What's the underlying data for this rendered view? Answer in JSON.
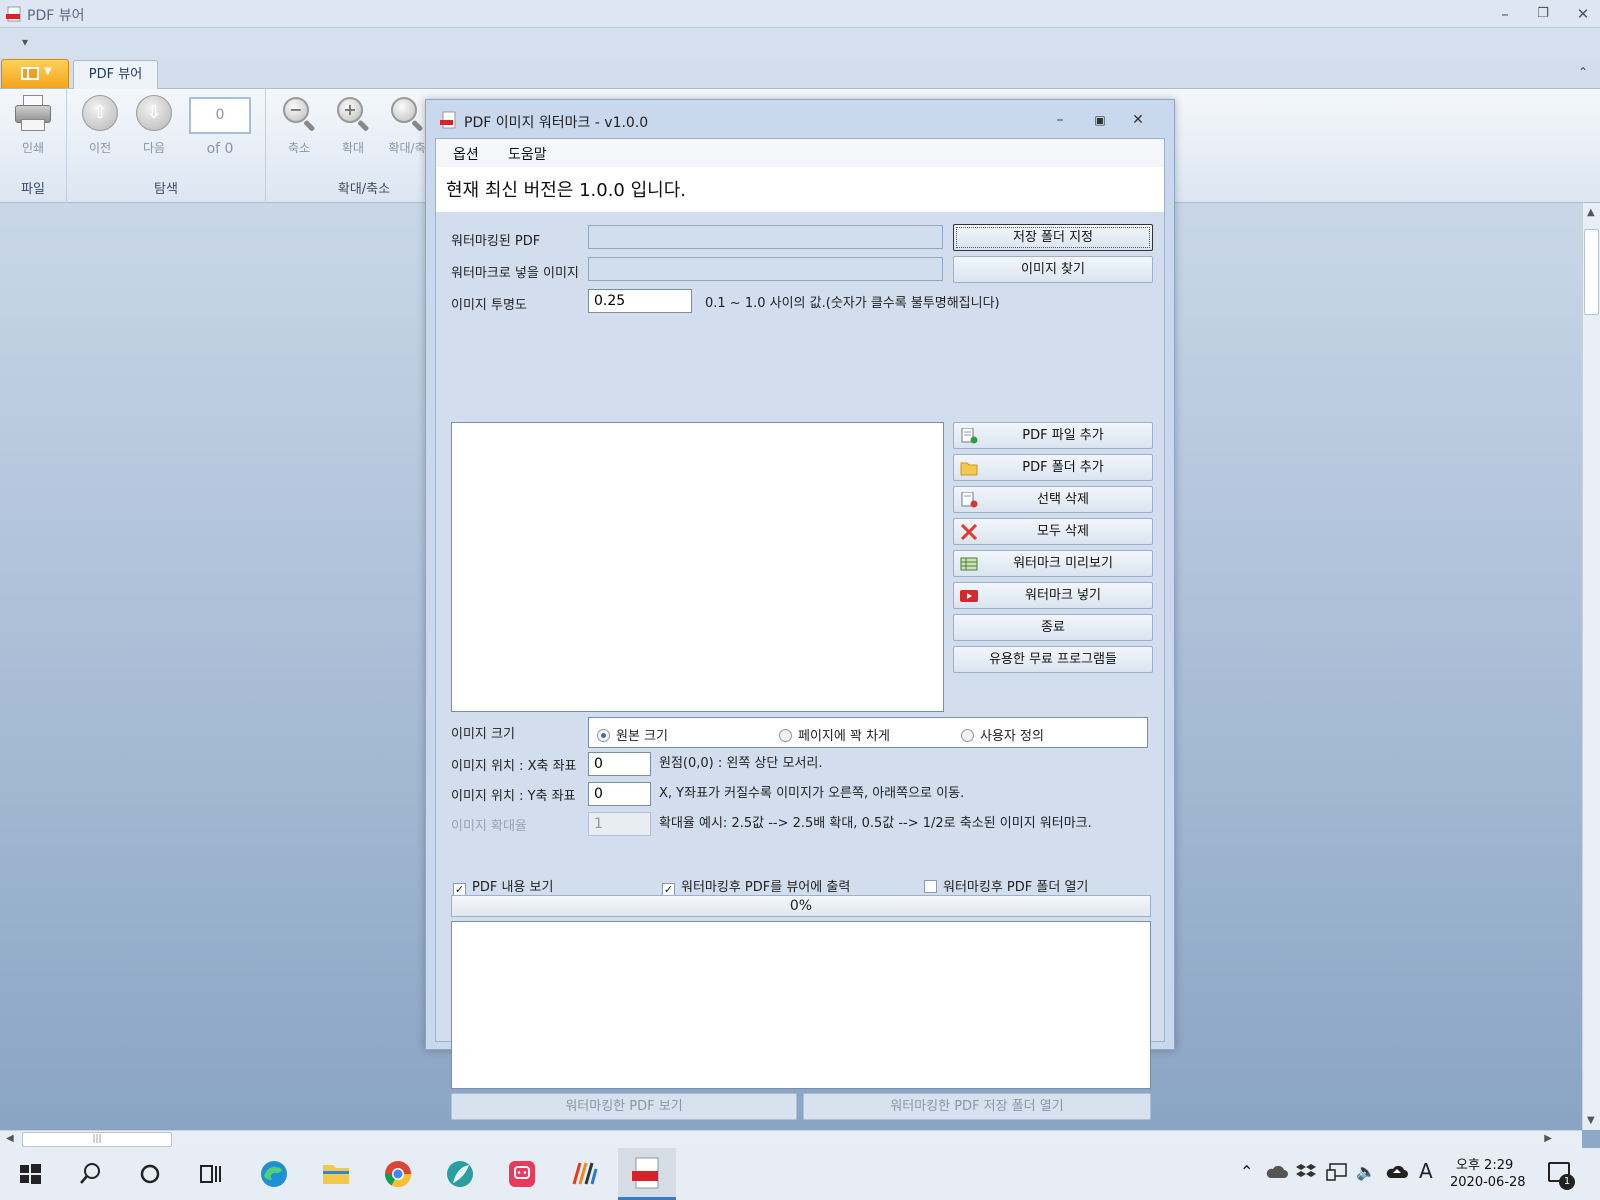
{
  "window": {
    "title": "PDF 뷰어"
  },
  "tabs": {
    "pdf_viewer": "PDF 뷰어"
  },
  "ribbon": {
    "print": "인쇄",
    "prev": "이전",
    "next": "다음",
    "page_current": "0",
    "page_of": "of 0",
    "zoom_out": "축소",
    "zoom_in": "확대",
    "zoom_fit": "확대/축",
    "group_file": "파일",
    "group_nav": "탐색",
    "group_zoom": "확대/축소"
  },
  "dialog": {
    "title": "PDF 이미지 워터마크 - v1.0.0",
    "menu": {
      "options": "옵션",
      "help": "도움말"
    },
    "version_banner": "현재 최신 버전은 1.0.0 입니다.",
    "fields": {
      "watermarked_pdf_label": "워터마킹된 PDF",
      "watermarked_pdf_value": "",
      "image_label": "워터마크로 넣을 이미지",
      "image_value": "",
      "opacity_label": "이미지 투명도",
      "opacity_value": "0.25",
      "opacity_hint": "0.1 ~ 1.0 사이의 값.(숫자가 클수록 불투명해집니다)"
    },
    "buttons": {
      "save_folder": "저장 폴더 지정",
      "find_image": "이미지 찾기",
      "add_pdf_file": "PDF 파일 추가",
      "add_pdf_folder": "PDF 폴더 추가",
      "delete_selected": "선택 삭제",
      "delete_all": "모두 삭제",
      "preview": "워터마크 미리보기",
      "insert": "워터마크 넣기",
      "exit": "종료",
      "free_programs": "유용한 무료 프로그램들",
      "view_pdf": "워터마킹한 PDF 보기",
      "open_folder": "워터마킹한 PDF 저장 폴더 열기"
    },
    "size": {
      "label": "이미지 크기",
      "options": [
        "원본 크기",
        "페이지에 꽉 차게",
        "사용자 정의"
      ]
    },
    "position": {
      "x_label": "이미지 위치 : X축 좌표",
      "x_value": "0",
      "x_hint": "원점(0,0) : 왼쪽 상단 모서리.",
      "y_label": "이미지 위치 : Y축 좌표",
      "y_value": "0",
      "y_hint": "X, Y좌표가 커질수록 이미지가 오른쪽, 아래쪽으로 이동.",
      "scale_label": "이미지 확대율",
      "scale_value": "1",
      "scale_hint": "확대율 예시: 2.5값 --> 2.5배 확대, 0.5값 --> 1/2로 축소된 이미지 워터마크."
    },
    "checks": {
      "show_pdf": "PDF 내용 보기",
      "output_to_viewer": "워터마킹후 PDF를 뷰어에 출력",
      "open_folder_after": "워터마킹후 PDF 폴더 열기"
    },
    "progress": {
      "value": 0,
      "text": "0%"
    }
  },
  "taskbar": {
    "clock_time": "오후 2:29",
    "clock_date": "2020-06-28",
    "notif_count": "1",
    "ime": "A"
  }
}
